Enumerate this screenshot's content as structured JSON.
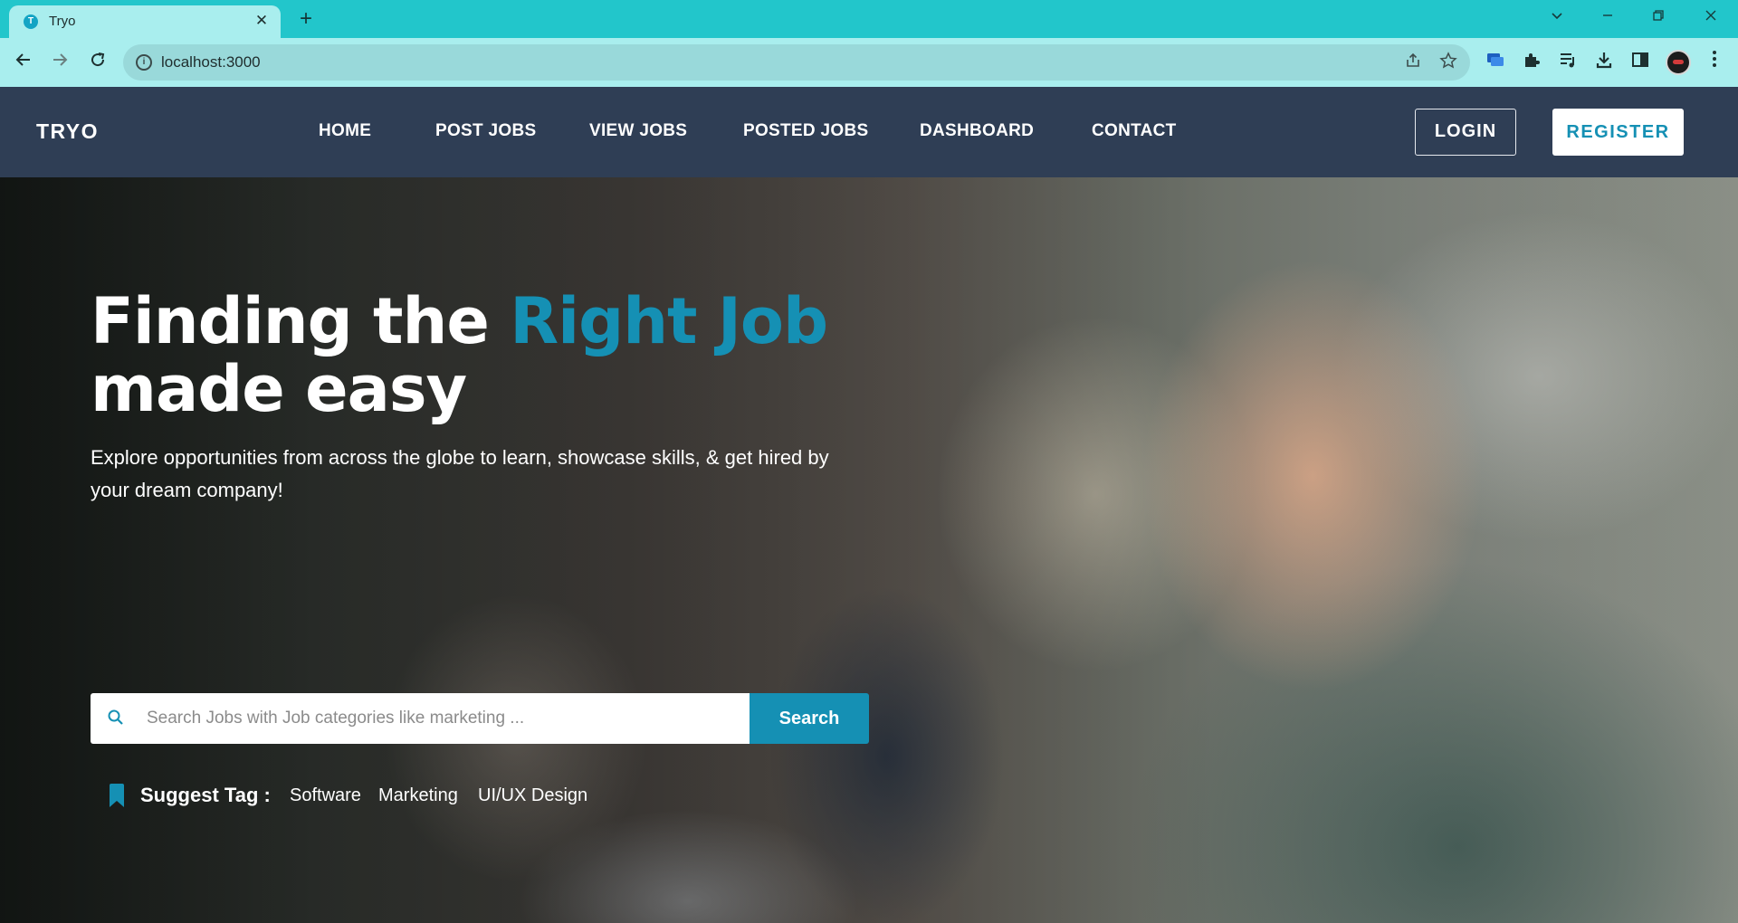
{
  "browser": {
    "tab_title": "Tryo",
    "tab_favicon": "T",
    "tab_close": "✕",
    "new_tab": "+",
    "url": "localhost:3000",
    "window_controls": [
      "chevron-down-icon",
      "minimize-icon",
      "restore-icon",
      "close-icon"
    ]
  },
  "site": {
    "brand": "TRYO",
    "menu": [
      "HOME",
      "POST JOBS",
      "VIEW JOBS",
      "POSTED JOBS",
      "DASHBOARD",
      "CONTACT"
    ],
    "login": "LOGIN",
    "register": "REGISTER"
  },
  "hero": {
    "title_part1": "Finding the ",
    "title_accent": "Right Job",
    "title_part2": "made easy",
    "subtitle": "Explore opportunities from across the globe to learn, showcase skills, & get hired by your dream company!",
    "search_placeholder": "Search Jobs with Job categories like marketing ...",
    "search_button": "Search",
    "tags_label": "Suggest Tag :",
    "tags": [
      "Software",
      "Marketing",
      "UI/UX Design"
    ]
  },
  "colors": {
    "accent": "#1590b4",
    "navbar": "#2f3e55",
    "browser_frame": "#22c6cb",
    "browser_toolbar": "#a9eeee"
  }
}
